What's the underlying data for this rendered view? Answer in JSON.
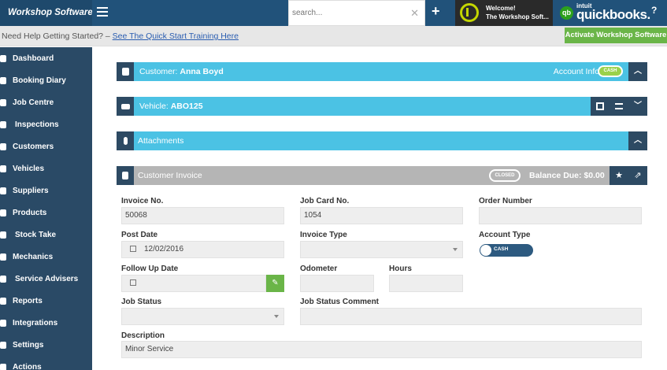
{
  "topbar": {
    "brand": "Workshop Software",
    "search_placeholder": "search...",
    "welcome_line1": "Welcome!",
    "welcome_line2": "The Workshop Soft...",
    "qb_small": "intuit",
    "qb_name": "quickbooks.",
    "qb_badge": "qb",
    "help_glyph": "?"
  },
  "helpbar": {
    "prefix": "Need Help Getting Started? – ",
    "link": "See The Quick Start Training Here",
    "activate": "Activate Workshop Software"
  },
  "sidebar": {
    "items": [
      {
        "label": "Dashboard",
        "icon": "dashboard-icon"
      },
      {
        "label": "Booking Diary",
        "icon": "calendar-icon"
      },
      {
        "label": "Job Centre",
        "icon": "star-icon"
      },
      {
        "label": "Inspections",
        "icon": "search-icon"
      },
      {
        "label": "Customers",
        "icon": "users-icon"
      },
      {
        "label": "Vehicles",
        "icon": "car-icon"
      },
      {
        "label": "Suppliers",
        "icon": "truck-icon"
      },
      {
        "label": "Products",
        "icon": "tag-icon"
      },
      {
        "label": "Stock Take",
        "icon": "box-icon"
      },
      {
        "label": "Mechanics",
        "icon": "wrench-icon"
      },
      {
        "label": "Service Advisers",
        "icon": "user-icon"
      },
      {
        "label": "Reports",
        "icon": "chart-icon"
      },
      {
        "label": "Integrations",
        "icon": "plug-icon"
      },
      {
        "label": "Settings",
        "icon": "gear-icon"
      },
      {
        "label": "Actions",
        "icon": "bolt-icon"
      }
    ]
  },
  "panels": {
    "customer": {
      "prefix": "Customer: ",
      "name": "Anna Boyd",
      "account_info": "Account Info:",
      "cash": "CASH"
    },
    "vehicle": {
      "prefix": "Vehicle: ",
      "rego": "ABO125"
    },
    "attachments": {
      "title": "Attachments"
    },
    "invoice": {
      "title": "Customer Invoice",
      "status": "CLOSED",
      "balance": "Balance Due: $0.00"
    }
  },
  "form": {
    "invoice_no_label": "Invoice No.",
    "invoice_no": "50068",
    "job_card_label": "Job Card No.",
    "job_card": "1054",
    "order_number_label": "Order Number",
    "order_number": "",
    "post_date_label": "Post Date",
    "post_date": "12/02/2016",
    "invoice_type_label": "Invoice Type",
    "invoice_type": "",
    "account_type_label": "Account Type",
    "account_type": "CASH",
    "follow_up_label": "Follow Up Date",
    "follow_up": "",
    "odometer_label": "Odometer",
    "odometer": "",
    "hours_label": "Hours",
    "hours": "",
    "job_status_label": "Job Status",
    "job_status": "",
    "job_status_comment_label": "Job Status Comment",
    "job_status_comment": "",
    "description_label": "Description",
    "description": "Minor Service"
  },
  "colors": {
    "topbar": "#21527a",
    "sidebar": "#2a4a66",
    "panel": "#4bc2e4",
    "accent_green": "#6ab548"
  }
}
